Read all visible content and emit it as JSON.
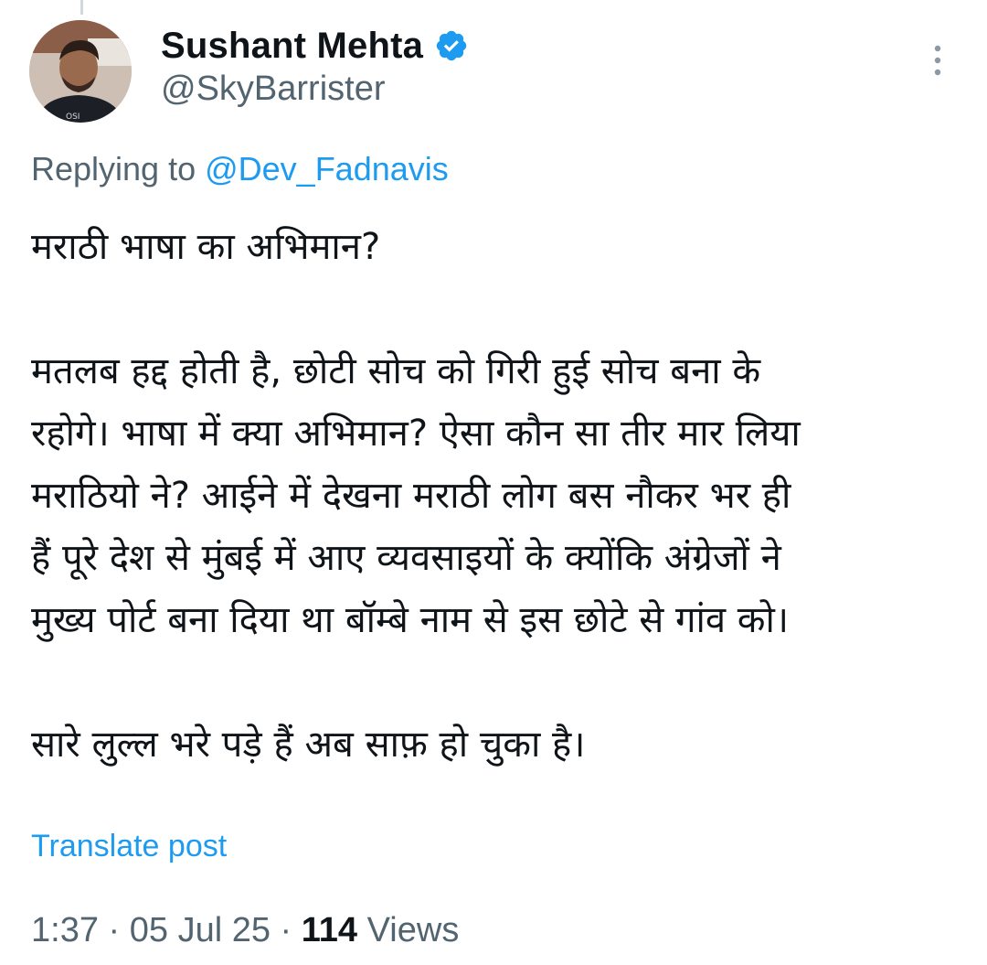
{
  "author": {
    "display_name": "Sushant Mehta",
    "handle": "@SkyBarrister",
    "verified": true
  },
  "reply": {
    "prefix": "Replying to ",
    "mention": "@Dev_Fadnavis"
  },
  "post": {
    "paragraph1": [
      "मराठी भाषा का अभिमान?"
    ],
    "paragraph2": [
      "मतलब हद्द होती है, छोटी सोच को गिरी हुई सोच बना के",
      "रहोगे। भाषा में क्या अभिमान? ऐसा कौन सा तीर मार लिया",
      "मराठियो ने? आईने में देखना मराठी लोग बस नौकर भर ही",
      "हैं पूरे देश से मुंबई में आए व्यवसाइयों के क्योंकि अंग्रेजों ने",
      "मुख्य पोर्ट बना दिया था बॉम्बे नाम से इस छोटे से गांव को।"
    ],
    "paragraph3": [
      "सारे लुल्ल भरे पड़े हैं अब साफ़ हो चुका है।"
    ]
  },
  "translate_label": "Translate post",
  "meta": {
    "time": "1:37",
    "separator": " · ",
    "date": "05 Jul 25",
    "views_count": "114",
    "views_label": " Views"
  },
  "icons": {
    "more": "more-vertical-icon",
    "verified": "verified-badge-icon"
  },
  "colors": {
    "accent": "#1d9bf0",
    "secondary_text": "#536471",
    "primary_text": "#0f1419"
  }
}
